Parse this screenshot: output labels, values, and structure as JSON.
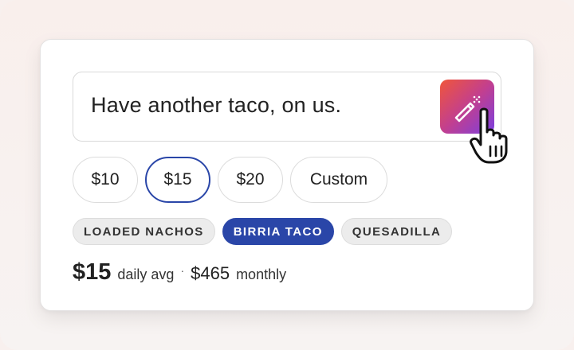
{
  "message": {
    "text": "Have another taco, on us."
  },
  "amounts": [
    {
      "label": "$10",
      "selected": false
    },
    {
      "label": "$15",
      "selected": true
    },
    {
      "label": "$20",
      "selected": false
    },
    {
      "label": "Custom",
      "selected": false
    }
  ],
  "tags": [
    {
      "label": "LOADED NACHOS",
      "selected": false
    },
    {
      "label": "BIRRIA TACO",
      "selected": true
    },
    {
      "label": "QUESADILLA",
      "selected": false
    }
  ],
  "summary": {
    "daily_amount": "$15",
    "daily_label": "daily avg",
    "separator": "·",
    "monthly_amount": "$465",
    "monthly_label": "monthly"
  },
  "colors": {
    "accent": "#2a46a8",
    "magic_gradient_start": "#f0563a",
    "magic_gradient_end": "#7a3fe0"
  },
  "icons": {
    "magic_button": "magic-wand-icon",
    "cursor": "pointer-hand-icon"
  }
}
